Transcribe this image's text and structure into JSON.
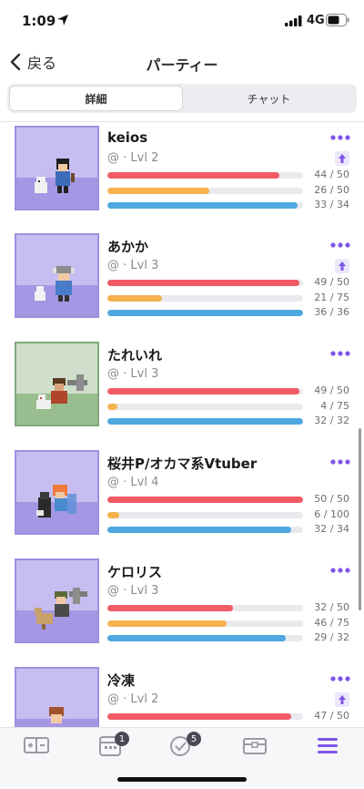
{
  "status_bar": {
    "time": "1:09",
    "network": "4G"
  },
  "nav": {
    "back_label": "戻る",
    "title": "パーティー"
  },
  "segment": {
    "tabs": [
      {
        "label": "詳細",
        "active": true
      },
      {
        "label": "チャット",
        "active": false
      }
    ]
  },
  "members": [
    {
      "name": "keios",
      "level": "@ · Lvl 2",
      "hp": "44 / 50",
      "xp": "26 / 50",
      "mp": "33 / 34",
      "hp_frac": 0.88,
      "xp_frac": 0.52,
      "mp_frac": 0.97,
      "upgrade": true,
      "bg": "purple"
    },
    {
      "name": "あかか",
      "level": "@ · Lvl 3",
      "hp": "49 / 50",
      "xp": "21 / 75",
      "mp": "36 / 36",
      "hp_frac": 0.98,
      "xp_frac": 0.28,
      "mp_frac": 1.0,
      "upgrade": true,
      "bg": "purple"
    },
    {
      "name": "たれいれ",
      "level": "@ · Lvl 3",
      "hp": "49 / 50",
      "xp": "4 / 75",
      "mp": "32 / 32",
      "hp_frac": 0.98,
      "xp_frac": 0.05,
      "mp_frac": 1.0,
      "upgrade": false,
      "bg": "green"
    },
    {
      "name": "桜井P/オカマ系Vtuber",
      "level": "@ · Lvl 4",
      "hp": "50 / 50",
      "xp": "6 / 100",
      "mp": "32 / 34",
      "hp_frac": 1.0,
      "xp_frac": 0.06,
      "mp_frac": 0.94,
      "upgrade": false,
      "bg": "purple"
    },
    {
      "name": "ケロリス",
      "level": "@ · Lvl 3",
      "hp": "32 / 50",
      "xp": "46 / 75",
      "mp": "29 / 32",
      "hp_frac": 0.64,
      "xp_frac": 0.61,
      "mp_frac": 0.91,
      "upgrade": false,
      "bg": "purple"
    },
    {
      "name": "冷凍",
      "level": "@ · Lvl 2",
      "hp": "47 / 50",
      "xp": "",
      "mp": "",
      "hp_frac": 0.94,
      "xp_frac": 0,
      "mp_frac": 0,
      "upgrade": true,
      "bg": "purple"
    }
  ],
  "tabbar": {
    "items": [
      {
        "icon": "habits-icon"
      },
      {
        "icon": "dailies-icon",
        "badge": "1"
      },
      {
        "icon": "todos-icon",
        "badge": "5"
      },
      {
        "icon": "rewards-icon"
      },
      {
        "icon": "menu-icon",
        "active": true
      }
    ]
  },
  "colors": {
    "accent": "#7f55e6",
    "hp": "#f05b64",
    "xp": "#f5b24e",
    "mp": "#4fa8e0"
  }
}
